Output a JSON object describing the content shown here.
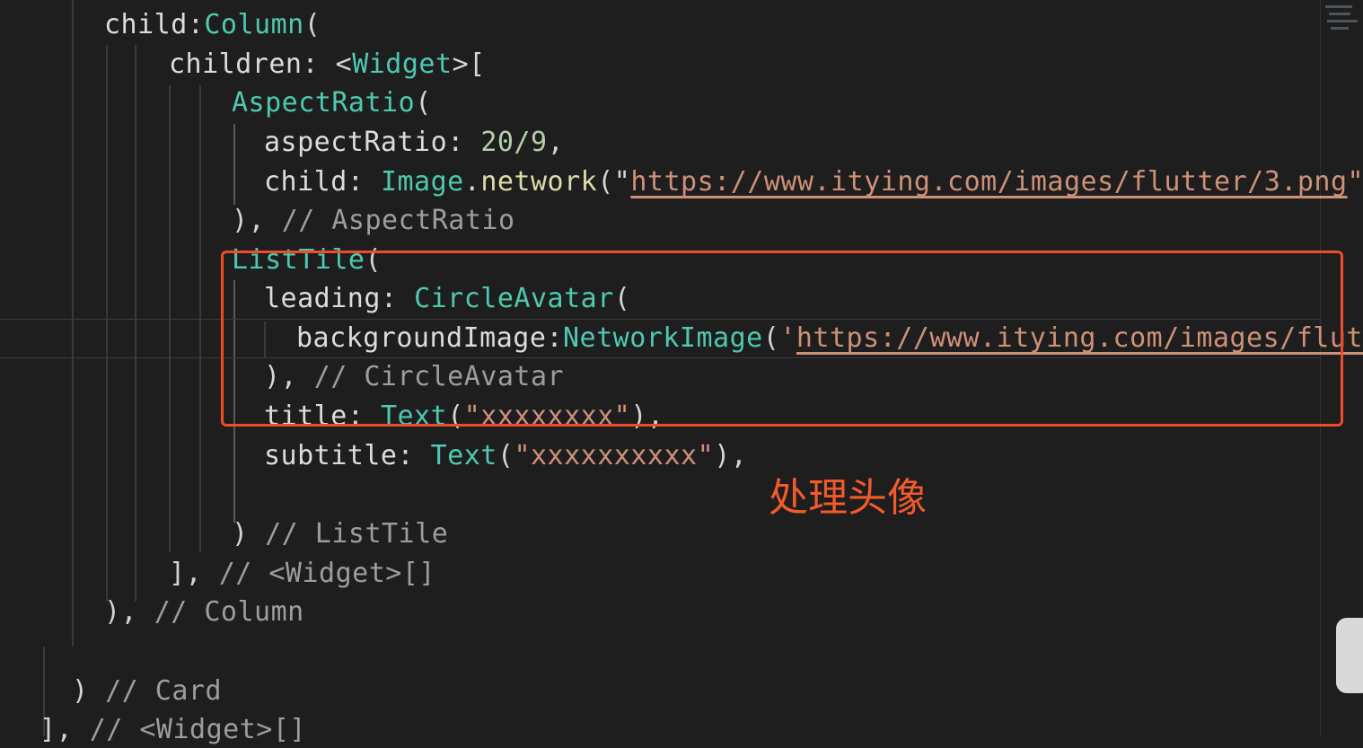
{
  "code_lines": [
    {
      "tokens": [
        [
          "prop",
          "child"
        ],
        [
          "punc",
          ":"
        ],
        [
          "kw-class",
          "Column"
        ],
        [
          "punc",
          "("
        ]
      ]
    },
    {
      "tokens": [
        [
          "prop",
          "children"
        ],
        [
          "punc",
          ": <"
        ],
        [
          "kw-class",
          "Widget"
        ],
        [
          "punc",
          ">["
        ]
      ]
    },
    {
      "tokens": [
        [
          "kw-class",
          "AspectRatio"
        ],
        [
          "punc",
          "("
        ]
      ]
    },
    {
      "tokens": [
        [
          "prop",
          "aspectRatio"
        ],
        [
          "punc",
          ": "
        ],
        [
          "num",
          "20/9"
        ],
        [
          "punc",
          ","
        ]
      ]
    },
    {
      "tokens": [
        [
          "prop",
          "child"
        ],
        [
          "punc",
          ": "
        ],
        [
          "kw-class",
          "Image"
        ],
        [
          "punc",
          "."
        ],
        [
          "method",
          "network"
        ],
        [
          "punc",
          "(\""
        ],
        [
          "str-u",
          "https://www.itying.com/images/flutter/3.png"
        ],
        [
          "str",
          "\""
        ]
      ]
    },
    {
      "tokens": [
        [
          "punc",
          "), "
        ],
        [
          "cmt",
          "// AspectRatio"
        ]
      ]
    },
    {
      "tokens": [
        [
          "kw-class",
          "ListTile"
        ],
        [
          "punc",
          "("
        ]
      ]
    },
    {
      "tokens": [
        [
          "prop",
          "leading"
        ],
        [
          "punc",
          ": "
        ],
        [
          "kw-class",
          "CircleAvatar"
        ],
        [
          "punc",
          "("
        ]
      ]
    },
    {
      "tokens": [
        [
          "prop",
          "backgroundImage"
        ],
        [
          "punc",
          ":"
        ],
        [
          "kw-class",
          "NetworkImage"
        ],
        [
          "punc",
          "("
        ],
        [
          "str",
          "'"
        ],
        [
          "str-u",
          "https://www.itying.com/images/flut"
        ]
      ]
    },
    {
      "tokens": [
        [
          "punc",
          "), "
        ],
        [
          "cmt",
          "// CircleAvatar"
        ]
      ]
    },
    {
      "tokens": [
        [
          "prop",
          "title"
        ],
        [
          "punc",
          ": "
        ],
        [
          "kw-class",
          "Text"
        ],
        [
          "punc",
          "("
        ],
        [
          "str",
          "\"xxxxxxxx\""
        ],
        [
          "punc",
          "),"
        ]
      ]
    },
    {
      "tokens": [
        [
          "prop",
          "subtitle"
        ],
        [
          "punc",
          ": "
        ],
        [
          "kw-class",
          "Text"
        ],
        [
          "punc",
          "("
        ],
        [
          "str",
          "\"xxxxxxxxxx\""
        ],
        [
          "punc",
          "),"
        ]
      ]
    },
    {
      "tokens": []
    },
    {
      "tokens": [
        [
          "punc",
          ") "
        ],
        [
          "cmt",
          "// ListTile"
        ]
      ]
    },
    {
      "tokens": [
        [
          "punc",
          "], "
        ],
        [
          "cmt",
          "// <Widget>[]"
        ]
      ]
    },
    {
      "tokens": [
        [
          "punc",
          "), "
        ],
        [
          "cmt",
          "// Column"
        ]
      ]
    },
    {
      "tokens": []
    },
    {
      "tokens": [
        [
          "punc",
          ") "
        ],
        [
          "cmt",
          "// Card"
        ]
      ]
    },
    {
      "tokens": [
        [
          "punc",
          "], "
        ],
        [
          "cmt",
          "// <Widget>[]"
        ]
      ]
    }
  ],
  "annotation": {
    "label": "处理头像",
    "color": "#f04a2a"
  },
  "theme": {
    "background": "#1e1e1e",
    "class_color": "#4ec9b0",
    "string_color": "#ce9178",
    "comment_color": "#9d9d9d",
    "number_color": "#b5cea8"
  }
}
